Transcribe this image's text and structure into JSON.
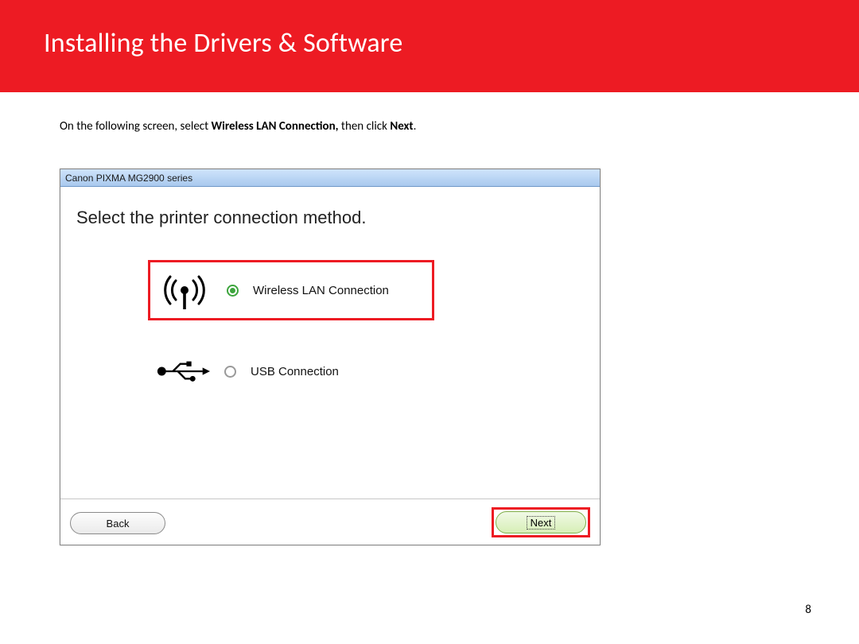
{
  "header": {
    "title": "Installing  the Drivers & Software"
  },
  "instruction": {
    "pre": "On the following screen, select ",
    "bold1": "Wireless  LAN Connection, ",
    "mid": "then click ",
    "bold2": "Next",
    "post": "."
  },
  "window": {
    "title": "Canon PIXMA MG2900 series",
    "prompt": "Select the printer connection method.",
    "options": {
      "wifi": "Wireless LAN Connection",
      "usb": "USB Connection"
    },
    "buttons": {
      "back": "Back",
      "next": "Next"
    }
  },
  "pagenum": "8"
}
